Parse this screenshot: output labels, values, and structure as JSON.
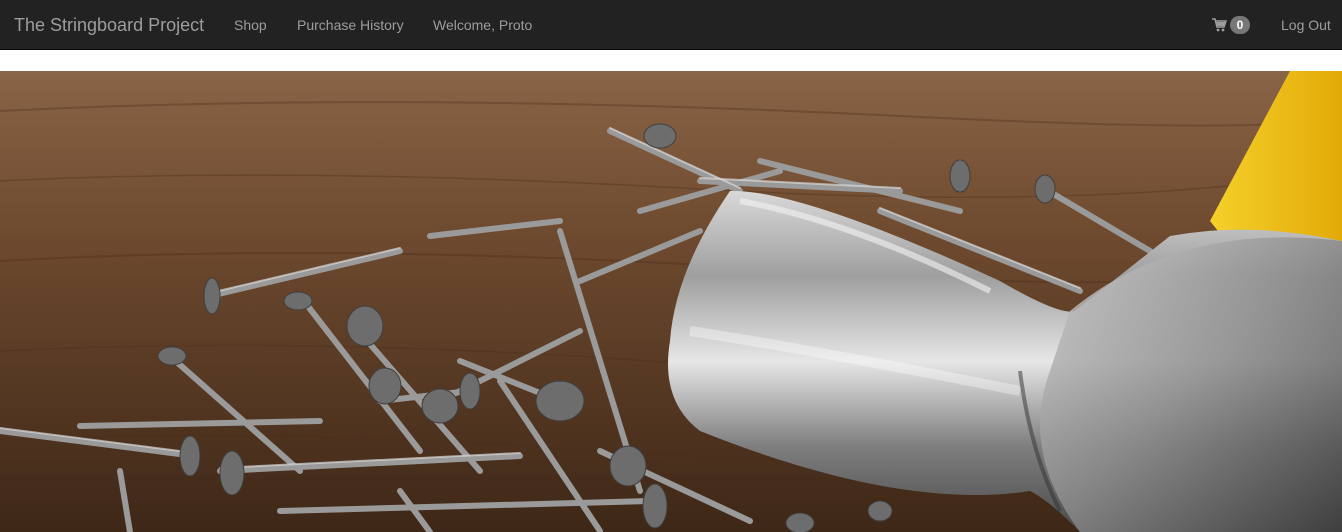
{
  "navbar": {
    "brand": "The Stringboard Project",
    "links": [
      {
        "label": "Shop"
      },
      {
        "label": "Purchase History"
      },
      {
        "label": "Welcome, Proto"
      }
    ],
    "cart": {
      "icon": "shopping-cart-icon",
      "count": "0"
    },
    "logout": "Log Out"
  },
  "hero": {
    "subject": "pile of nails with a steel hammer on a wooden table",
    "colors": {
      "wood": "#5b3a22",
      "steel": "#a7a7a7",
      "handle": "#f2c81a"
    }
  }
}
